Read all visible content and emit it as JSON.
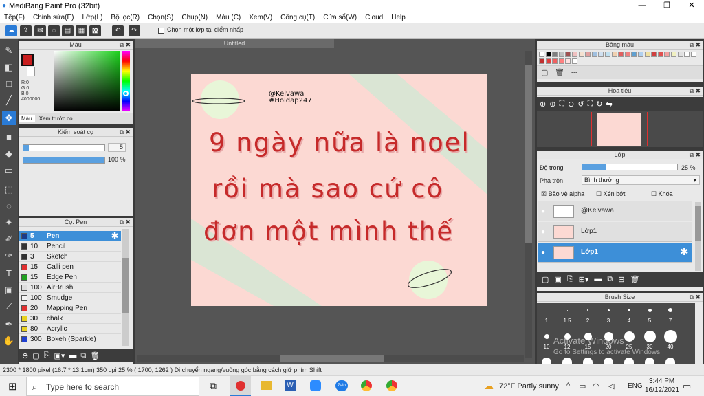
{
  "window": {
    "title": "MediBang Paint Pro (32bit)",
    "controls": [
      "—",
      "❐",
      "✕"
    ]
  },
  "menu": [
    "Tệp(F)",
    "Chỉnh sửa(E)",
    "Lớp(L)",
    "Bộ lọc(R)",
    "Chọn(S)",
    "Chụp(N)",
    "Màu (C)",
    "Xem(V)",
    "Công cụ(T)",
    "Cửa sổ(W)",
    "Cloud",
    "Help"
  ],
  "toolbar": {
    "checkbox_label": "Chọn một lớp tại điểm nhấp",
    "undo_icon": "undo-icon",
    "redo_icon": "redo-icon"
  },
  "color_panel": {
    "title": "Màu",
    "r": "R:0",
    "g": "G:0",
    "b": "B:0",
    "hex": "#000000",
    "tabs": [
      "Màu",
      "Xem trước cọ"
    ],
    "primary": "#c81e1e",
    "secondary": "#ffffff"
  },
  "brush_control": {
    "title": "Kiểm soát cọ",
    "size": "5",
    "opacity": "100 %"
  },
  "brush_panel": {
    "title": "Cọ: Pen",
    "items": [
      {
        "size": "5",
        "name": "Pen",
        "color": "#1a3c8a",
        "selected": true
      },
      {
        "size": "10",
        "name": "Pencil",
        "color": "#333333"
      },
      {
        "size": "3",
        "name": "Sketch",
        "color": "#333333"
      },
      {
        "size": "15",
        "name": "Calli pen",
        "color": "#e03030"
      },
      {
        "size": "15",
        "name": "Edge Pen",
        "color": "#20a020"
      },
      {
        "size": "100",
        "name": "AirBrush",
        "color": "#dddddd"
      },
      {
        "size": "100",
        "name": "Smudge",
        "color": "#f4f4f4"
      },
      {
        "size": "20",
        "name": "Mapping Pen",
        "color": "#e03030"
      },
      {
        "size": "30",
        "name": "chalk",
        "color": "#e8d020"
      },
      {
        "size": "80",
        "name": "Acrylic",
        "color": "#e8d020"
      },
      {
        "size": "300",
        "name": "Bokeh (Sparkle)",
        "color": "#2040d0"
      }
    ]
  },
  "document": {
    "tab": "Untitled",
    "handle": "@Kelvawa",
    "hashtag": "#Holdap247",
    "line1": "9 ngày nữa là noel",
    "line2": "rồi mà sao cứ cô",
    "line3": "đơn một mình thế"
  },
  "palette": {
    "title": "Bảng màu",
    "dash": "---"
  },
  "navigator": {
    "title": "Hoa tiêu"
  },
  "layers": {
    "title": "Lớp",
    "opacity_label": "Độ trong",
    "opacity_value": "25 %",
    "opacity_fraction": 0.25,
    "blend_label": "Pha trộn",
    "blend_value": "Bình thường",
    "protect_alpha": "Bảo vệ alpha",
    "clipping": "Xén bớt",
    "lock": "Khóa",
    "items": [
      "@Kelvawa",
      "Lớp1",
      "Lớp1"
    ]
  },
  "brush_size": {
    "title": "Brush Size",
    "row1": [
      "1",
      "1.5",
      "2",
      "3",
      "4",
      "5",
      "7"
    ],
    "row2": [
      "10",
      "12",
      "15",
      "20",
      "25",
      "30",
      "40"
    ]
  },
  "watermark": {
    "line1": "Activate Windows",
    "line2": "Go to Settings to activate Windows."
  },
  "status": "2300 * 1800 pixel   (16.7 * 13.1cm)   350 dpi   25 %   ( 1700, 1262 )   Di chuyển ngang/vuông góc bằng cách giữ phím Shift",
  "taskbar": {
    "search_placeholder": "Type here to search",
    "weather": "72°F  Partly sunny",
    "lang": "ENG",
    "time": "3:44 PM",
    "date": "16/12/2021"
  }
}
